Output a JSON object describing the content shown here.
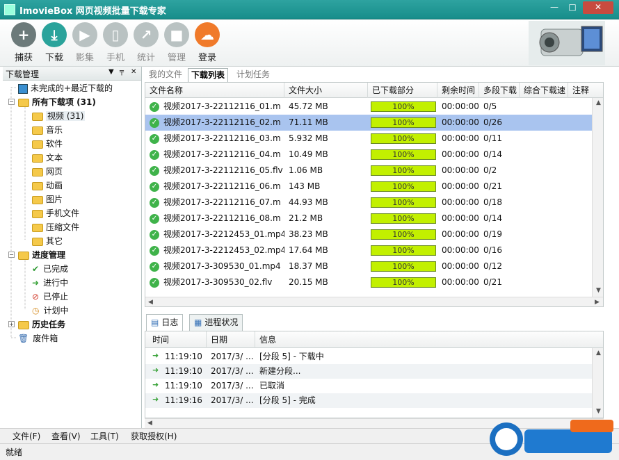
{
  "window": {
    "title": "ImovieBox 网页视频批量下载专家",
    "minimize": "—",
    "maximize": "□",
    "close": "✕"
  },
  "toolbar": {
    "items": [
      {
        "label": "捕获",
        "icon": "plus-icon",
        "color": "#6c7a7a",
        "enabled": true
      },
      {
        "label": "下载",
        "icon": "download-icon",
        "color": "#2aa39b",
        "enabled": true
      },
      {
        "label": "影集",
        "icon": "play-icon",
        "color": "#b9c2c2",
        "enabled": false
      },
      {
        "label": "手机",
        "icon": "phone-icon",
        "color": "#b9c2c2",
        "enabled": false
      },
      {
        "label": "统计",
        "icon": "chart-icon",
        "color": "#b9c2c2",
        "enabled": false
      },
      {
        "label": "管理",
        "icon": "lock-icon",
        "color": "#b9c2c2",
        "enabled": false
      },
      {
        "label": "登录",
        "icon": "cloud-icon",
        "color": "#f07a2a",
        "enabled": true
      }
    ]
  },
  "sidebar": {
    "title": "下载管理",
    "tree": [
      {
        "label": "未完成的+最近下载的",
        "icon": "disk-icon",
        "level": 0,
        "bold": false
      },
      {
        "label": "所有下载项 (31)",
        "icon": "folder-icon",
        "level": 0,
        "bold": true,
        "expander": "−"
      },
      {
        "label": "视频 (31)",
        "icon": "folder-icon",
        "level": 1,
        "bold": false,
        "selected": true
      },
      {
        "label": "音乐",
        "icon": "folder-icon",
        "level": 1,
        "bold": false
      },
      {
        "label": "软件",
        "icon": "folder-icon",
        "level": 1,
        "bold": false
      },
      {
        "label": "文本",
        "icon": "folder-icon",
        "level": 1,
        "bold": false
      },
      {
        "label": "网页",
        "icon": "folder-icon",
        "level": 1,
        "bold": false
      },
      {
        "label": "动画",
        "icon": "folder-icon",
        "level": 1,
        "bold": false
      },
      {
        "label": "图片",
        "icon": "folder-icon",
        "level": 1,
        "bold": false
      },
      {
        "label": "手机文件",
        "icon": "folder-icon",
        "level": 1,
        "bold": false
      },
      {
        "label": "压缩文件",
        "icon": "folder-icon",
        "level": 1,
        "bold": false
      },
      {
        "label": "其它",
        "icon": "folder-icon",
        "level": 1,
        "bold": false
      },
      {
        "label": "进度管理",
        "icon": "folder-icon",
        "level": 0,
        "bold": true,
        "expander": "−"
      },
      {
        "label": "已完成",
        "icon": "checkmark-icon",
        "level": 1,
        "bold": false
      },
      {
        "label": "进行中",
        "icon": "arrow-right-icon",
        "level": 1,
        "bold": false
      },
      {
        "label": "已停止",
        "icon": "stop-icon",
        "level": 1,
        "bold": false
      },
      {
        "label": "计划中",
        "icon": "clock-icon",
        "level": 1,
        "bold": false
      },
      {
        "label": "历史任务",
        "icon": "folder-icon",
        "level": 0,
        "bold": true,
        "expander": "+"
      },
      {
        "label": "废件箱",
        "icon": "trash-icon",
        "level": 0,
        "bold": false
      }
    ]
  },
  "main_tabs": [
    {
      "label": "我的文件",
      "active": false
    },
    {
      "label": "下载列表",
      "active": true
    },
    {
      "label": "计划任务",
      "active": false
    }
  ],
  "download_table": {
    "columns": [
      "文件名称",
      "文件大小",
      "已下载部分",
      "剩余时间",
      "多段下载",
      "综合下载速",
      "注释"
    ],
    "rows": [
      {
        "name": "视频2017-3-22112116_01.m",
        "size": "45.72 MB",
        "progress": 1.0,
        "progress_text": "100%",
        "remaining": "00:00:00",
        "segments": "0/5"
      },
      {
        "name": "视频2017-3-22112116_02.m",
        "size": "71.11 MB",
        "progress": 1.0,
        "progress_text": "100%",
        "remaining": "00:00:00",
        "segments": "0/26",
        "selected": true
      },
      {
        "name": "视频2017-3-22112116_03.m",
        "size": "5.932 MB",
        "progress": 1.0,
        "progress_text": "100%",
        "remaining": "00:00:00",
        "segments": "0/11"
      },
      {
        "name": "视频2017-3-22112116_04.m",
        "size": "10.49 MB",
        "progress": 1.0,
        "progress_text": "100%",
        "remaining": "00:00:00",
        "segments": "0/14"
      },
      {
        "name": "视频2017-3-22112116_05.flv",
        "size": "1.06 MB",
        "progress": 1.0,
        "progress_text": "100%",
        "remaining": "00:00:00",
        "segments": "0/2"
      },
      {
        "name": "视频2017-3-22112116_06.m",
        "size": "143 MB",
        "progress": 1.0,
        "progress_text": "100%",
        "remaining": "00:00:00",
        "segments": "0/21"
      },
      {
        "name": "视频2017-3-22112116_07.m",
        "size": "44.93 MB",
        "progress": 1.0,
        "progress_text": "100%",
        "remaining": "00:00:00",
        "segments": "0/18"
      },
      {
        "name": "视频2017-3-22112116_08.m",
        "size": "21.2 MB",
        "progress": 1.0,
        "progress_text": "100%",
        "remaining": "00:00:00",
        "segments": "0/14"
      },
      {
        "name": "视频2017-3-2212453_01.mp4",
        "size": "38.23 MB",
        "progress": 1.0,
        "progress_text": "100%",
        "remaining": "00:00:00",
        "segments": "0/19"
      },
      {
        "name": "视频2017-3-2212453_02.mp4",
        "size": "17.64 MB",
        "progress": 1.0,
        "progress_text": "100%",
        "remaining": "00:00:00",
        "segments": "0/16"
      },
      {
        "name": "视频2017-3-309530_01.mp4",
        "size": "18.37 MB",
        "progress": 1.0,
        "progress_text": "100%",
        "remaining": "00:00:00",
        "segments": "0/12"
      },
      {
        "name": "视频2017-3-309530_02.flv",
        "size": "20.15 MB",
        "progress": 1.0,
        "progress_text": "100%",
        "remaining": "00:00:00",
        "segments": "0/21"
      }
    ]
  },
  "bottom_tabs": [
    {
      "label": "日志",
      "icon": "book-icon",
      "active": true
    },
    {
      "label": "进程状况",
      "icon": "grid-icon",
      "active": false
    }
  ],
  "log_table": {
    "columns": [
      "时间",
      "日期",
      "信息"
    ],
    "rows": [
      {
        "time": "11:19:10",
        "date": "2017/3/ ...",
        "info": "[分段 5] - 下载中"
      },
      {
        "time": "11:19:10",
        "date": "2017/3/ ...",
        "info": "新建分段..."
      },
      {
        "time": "11:19:10",
        "date": "2017/3/ ...",
        "info": "已取消"
      },
      {
        "time": "11:19:16",
        "date": "2017/3/ ...",
        "info": "[分段 5] - 完成"
      }
    ]
  },
  "menubar": {
    "items": [
      "文件(F)",
      "查看(V)",
      "工具(T)",
      "获取授权(H)"
    ]
  },
  "status": {
    "text": "就绪"
  },
  "colors": {
    "titlebar": "#1f9895",
    "selection": "#a9c4ef",
    "progress_fill": "#c2f000",
    "ok_green": "#3fb34a"
  }
}
